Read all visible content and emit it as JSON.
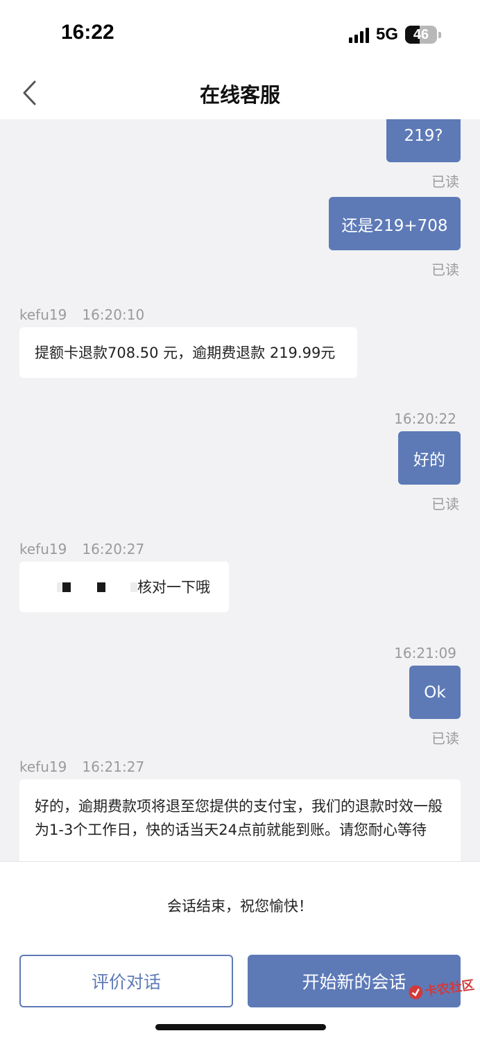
{
  "status_bar": {
    "time": "16:22",
    "network": "5G",
    "battery": "46",
    "battery_fraction": 0.46
  },
  "header": {
    "title": "在线客服"
  },
  "messages": {
    "m1": {
      "text": "219?",
      "read": "已读"
    },
    "m2": {
      "text": "还是219+708",
      "read": "已读"
    },
    "m3": {
      "sender": "kefu19",
      "time": "16:20:10",
      "text": "提额卡退款708.50 元，逾期费退款 219.99元"
    },
    "m4": {
      "time": "16:20:22",
      "text": "好的",
      "read": "已读"
    },
    "m5": {
      "sender": "kefu19",
      "time": "16:20:27",
      "text": "核对一下哦"
    },
    "m6": {
      "time": "16:21:09",
      "text": "Ok",
      "read": "已读"
    },
    "m7": {
      "sender": "kefu19",
      "time": "16:21:27",
      "text": "好的，逾期费款项将退至您提供的支付宝，我们的退款时效一般为1-3个工作日，快的话当天24点前就能到账。请您耐心等待"
    }
  },
  "footer": {
    "end_text": "会话结束，祝您愉快！",
    "rate_button": "评价对话",
    "new_button": "开始新的会话"
  },
  "watermark": {
    "text": "卡农社区",
    "color": "#d23a3a"
  },
  "colors": {
    "accent": "#5d7ab7",
    "chat_bg": "#f2f2f4",
    "muted": "#9a9a9a"
  }
}
